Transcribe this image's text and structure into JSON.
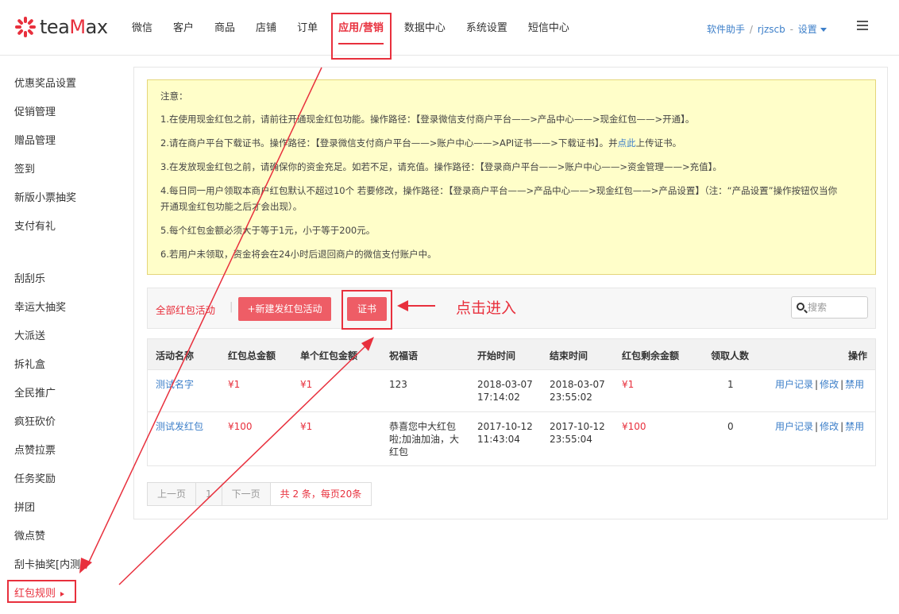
{
  "header": {
    "logo_prefix": "tea",
    "logo_highlight": "M",
    "logo_suffix": "ax",
    "nav": [
      "微信",
      "客户",
      "商品",
      "店铺",
      "订单",
      "应用/营销",
      "数据中心",
      "系统设置",
      "短信中心"
    ],
    "user_links": {
      "helper": "软件助手",
      "sep": "/",
      "username": "rjzscb",
      "dash": "-",
      "settings": "设置"
    }
  },
  "sidebar": {
    "group1": [
      "优惠奖品设置",
      "促销管理",
      "赠品管理",
      "签到",
      "新版小票抽奖",
      "支付有礼"
    ],
    "group2": [
      "刮刮乐",
      "幸运大抽奖",
      "大派送",
      "拆礼盒",
      "全民推广",
      "疯狂砍价",
      "点赞拉票",
      "任务奖励",
      "拼团",
      "微点赞",
      "刮卡抽奖[内测]"
    ],
    "active": "红包规则"
  },
  "notice": {
    "title": "注意：",
    "line1": "1.在使用现金红包之前，请前往开通现金红包功能。操作路径：【登录微信支付商户平台——>产品中心——>现金红包——>开通】。",
    "line2_a": "2.请在商户平台下载证书。操作路径：【登录微信支付商户平台——>账户中心——>API证书——>下载证书】。并",
    "line2_link": "点此",
    "line2_b": "上传证书。",
    "line3": "3.在发放现金红包之前，请确保你的资金充足。如若不足，请充值。操作路径：【登录商户平台——>账户中心——>资金管理——>充值】。",
    "line4a": "4.每日同一用户领取本商户红包默认不超过10个 若要修改，操作路径：【登录商户平台——>产品中心——>现金红包——>产品设置】（注：“产品设置”操作按钮仅当你",
    "line4b": "开通现金红包功能之后才会出现）。",
    "line5": "5.每个红包金额必须大于等于1元，小于等于200元。",
    "line6": "6.若用户未领取，资金将会在24小时后退回商户的微信支付账户中。"
  },
  "toolbar": {
    "all_label": "全部红包活动",
    "sep": "|",
    "new_button": "+新建发红包活动",
    "cert_button": "证书",
    "annotation": "点击进入",
    "search_placeholder": "搜索"
  },
  "table": {
    "headers": [
      "活动名称",
      "红包总金额",
      "单个红包金额",
      "祝福语",
      "开始时间",
      "结束时间",
      "红包剩余金额",
      "领取人数",
      "操作"
    ],
    "rows": [
      {
        "name": "测试名字",
        "total": "¥1",
        "single": "¥1",
        "blessing": "123",
        "start_date": "2018-03-07",
        "start_time": "17:14:02",
        "end_date": "2018-03-07",
        "end_time": "23:55:02",
        "remaining": "¥1",
        "count": "1",
        "op1": "用户记录",
        "op2": "修改",
        "op3": "禁用"
      },
      {
        "name": "测试发红包",
        "total": "¥100",
        "single": "¥1",
        "blessing_l1": "恭喜您中大红包",
        "blessing_l2": "啦;加油加油，大",
        "blessing_l3": "红包",
        "start_date": "2017-10-12",
        "start_time": "11:43:04",
        "end_date": "2017-10-12",
        "end_time": "23:55:04",
        "remaining": "¥100",
        "count": "0",
        "op1": "用户记录",
        "op2": "修改",
        "op3": "禁用"
      }
    ]
  },
  "pager": {
    "prev": "上一页",
    "page": "1",
    "next": "下一页",
    "info": "共 2 条，每页20条"
  },
  "colors": {
    "accent": "#e8303d",
    "button": "#ee5d66",
    "link": "#3d7fc9",
    "notice_bg": "#fffec9"
  }
}
